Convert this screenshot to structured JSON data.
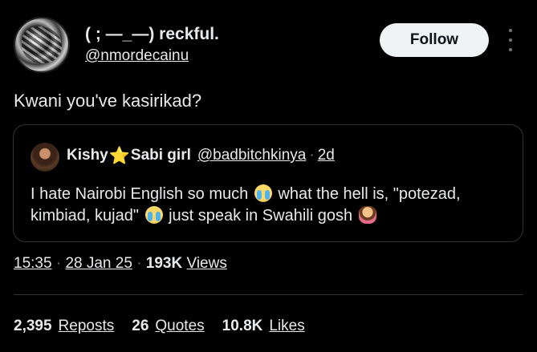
{
  "author": {
    "display_name": "( ; —_—) reckful.",
    "handle": "@nmordecainu"
  },
  "follow_button": {
    "label": "Follow"
  },
  "tweet": {
    "text": "Kwani you've kasirikad?"
  },
  "quoted": {
    "name_part1": "Kishy",
    "star_icon": "⭐",
    "name_part2": "Sabi girl",
    "handle": "@badbitchkinya",
    "separator": "·",
    "time": "2d",
    "line1_a": "I hate Nairobi English so much",
    "line1_b": "what the hell is, \"potezad,",
    "line2_a": "kimbiad, kujad\"",
    "line2_b": "just speak in Swahili gosh"
  },
  "meta": {
    "time": "15:35",
    "sep1": "·",
    "date": "28 Jan 25",
    "sep2": "·",
    "views_count": "193K",
    "views_label": "Views"
  },
  "stats": {
    "reposts_count": "2,395",
    "reposts_label": "Reposts",
    "quotes_count": "26",
    "quotes_label": "Quotes",
    "likes_count": "10.8K",
    "likes_label": "Likes"
  },
  "icons": {
    "more": "more-vertical-icon",
    "cry_emoji": "loudly-crying-face-emoji",
    "shrug_emoji": "person-shrugging-emoji"
  },
  "colors": {
    "background": "#000000",
    "text_primary": "#e7e9ea",
    "text_secondary": "#71767b",
    "border": "#2f3336",
    "follow_bg": "#eff3f4",
    "star": "#f5b418"
  }
}
